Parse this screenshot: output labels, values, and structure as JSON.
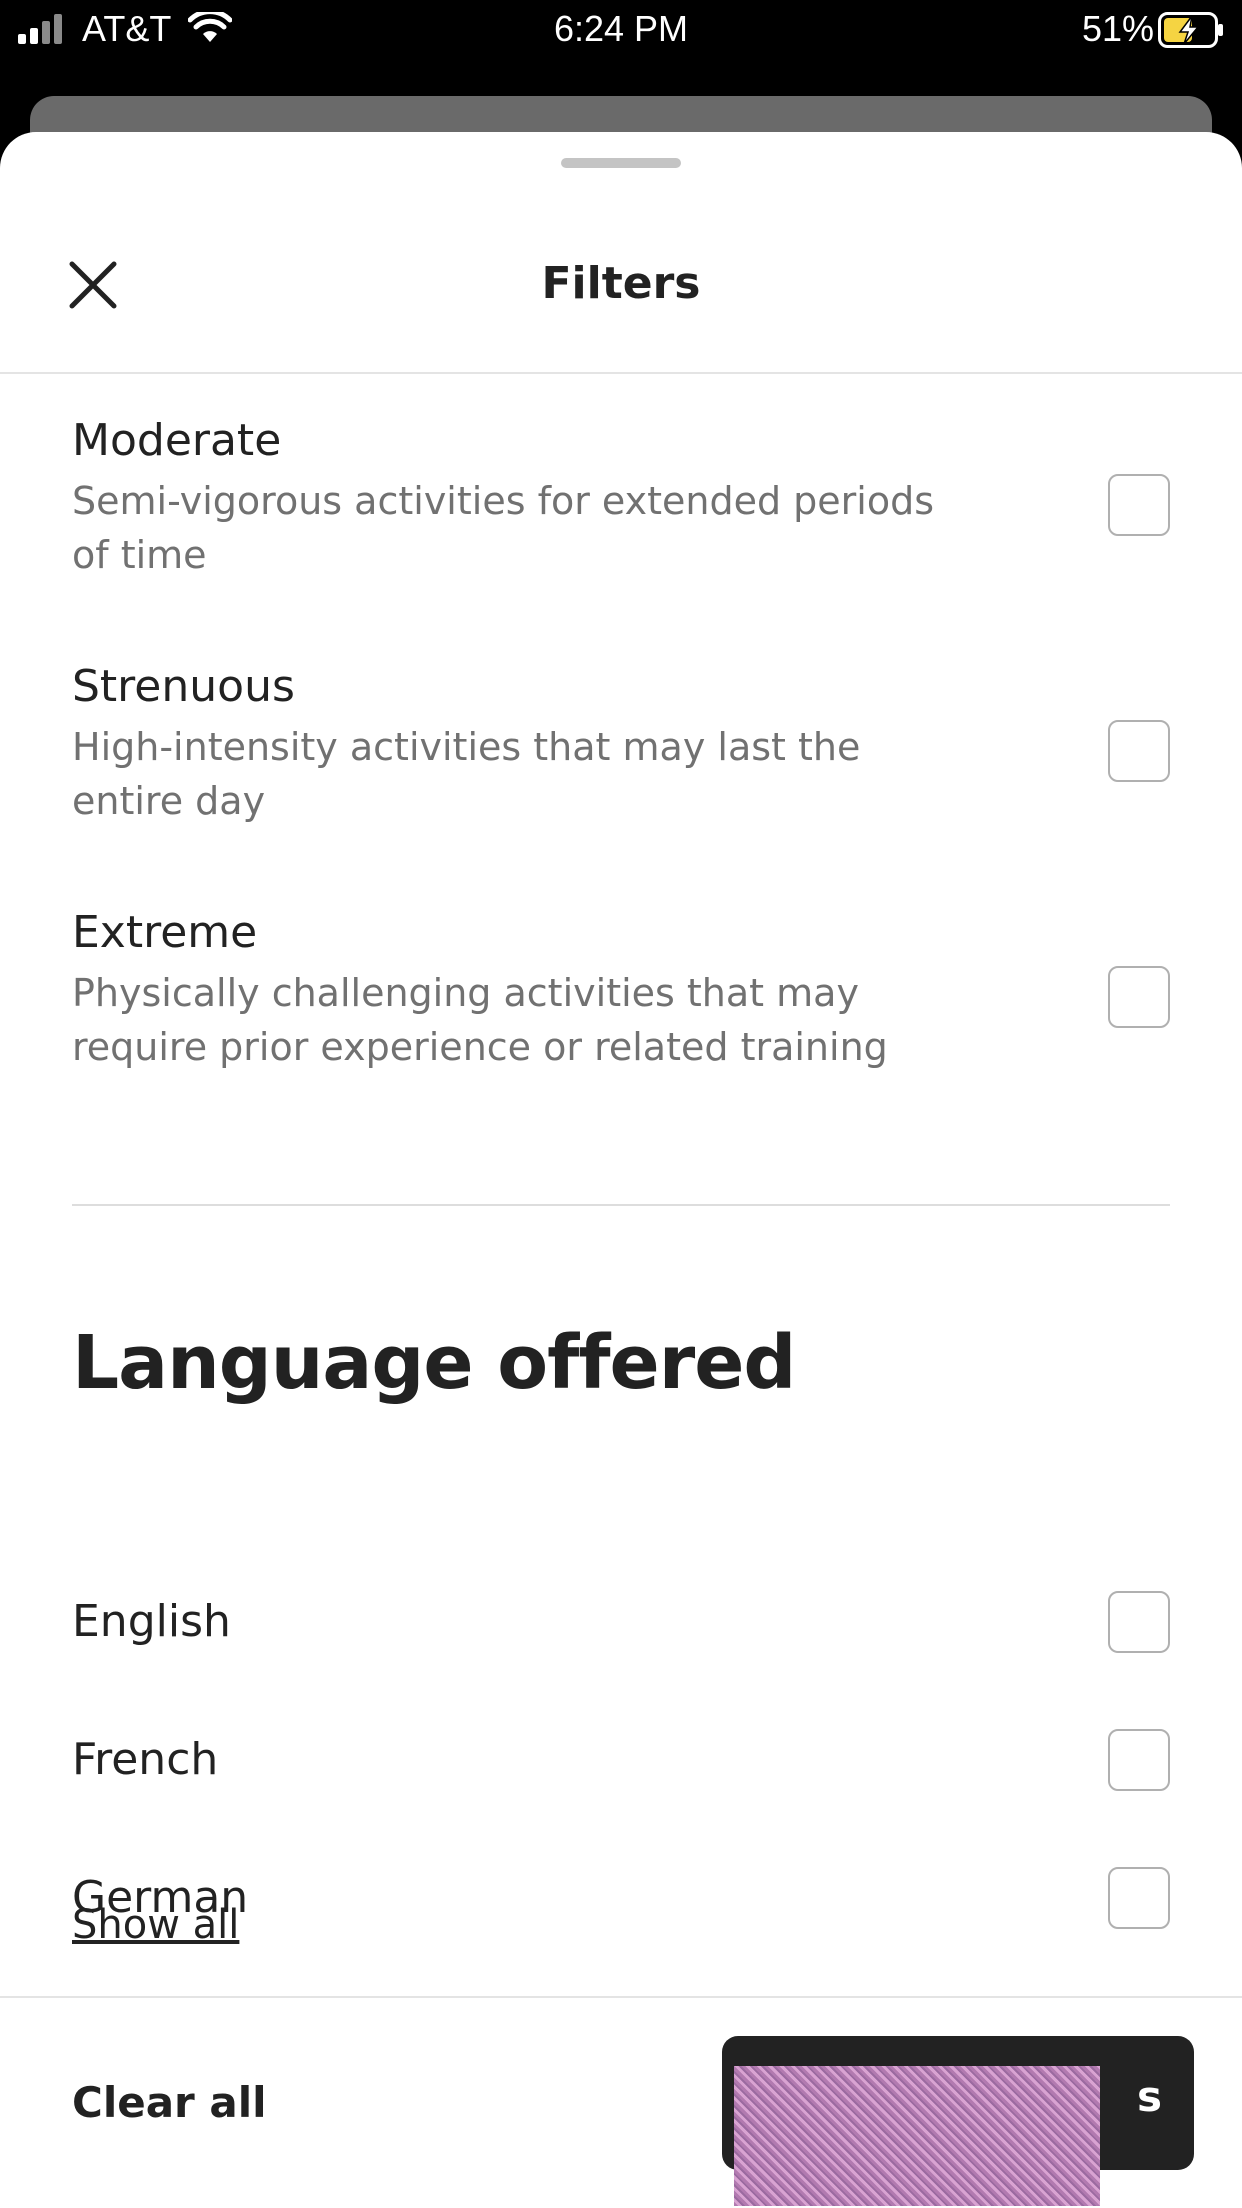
{
  "status_bar": {
    "carrier": "AT&T",
    "time": "6:24 PM",
    "battery_percent": "51%"
  },
  "sheet": {
    "title": "Filters"
  },
  "intensity_options": [
    {
      "title": "Moderate",
      "description": "Semi-vigorous activities for extended periods of time",
      "checked": false
    },
    {
      "title": "Strenuous",
      "description": "High-intensity activities that may last the entire day",
      "checked": false
    },
    {
      "title": "Extreme",
      "description": "Physically challenging activities that may require prior experience or related training",
      "checked": false
    }
  ],
  "language": {
    "heading": "Language offered",
    "options": [
      {
        "label": "English",
        "checked": false
      },
      {
        "label": "French",
        "checked": false
      },
      {
        "label": "German",
        "checked": false
      }
    ],
    "show_all": "Show all"
  },
  "footer": {
    "clear_all": "Clear all",
    "show_button_visible_text": "s"
  },
  "colors": {
    "text_primary": "#222222",
    "text_secondary": "#717171",
    "button_bg": "#222222"
  }
}
